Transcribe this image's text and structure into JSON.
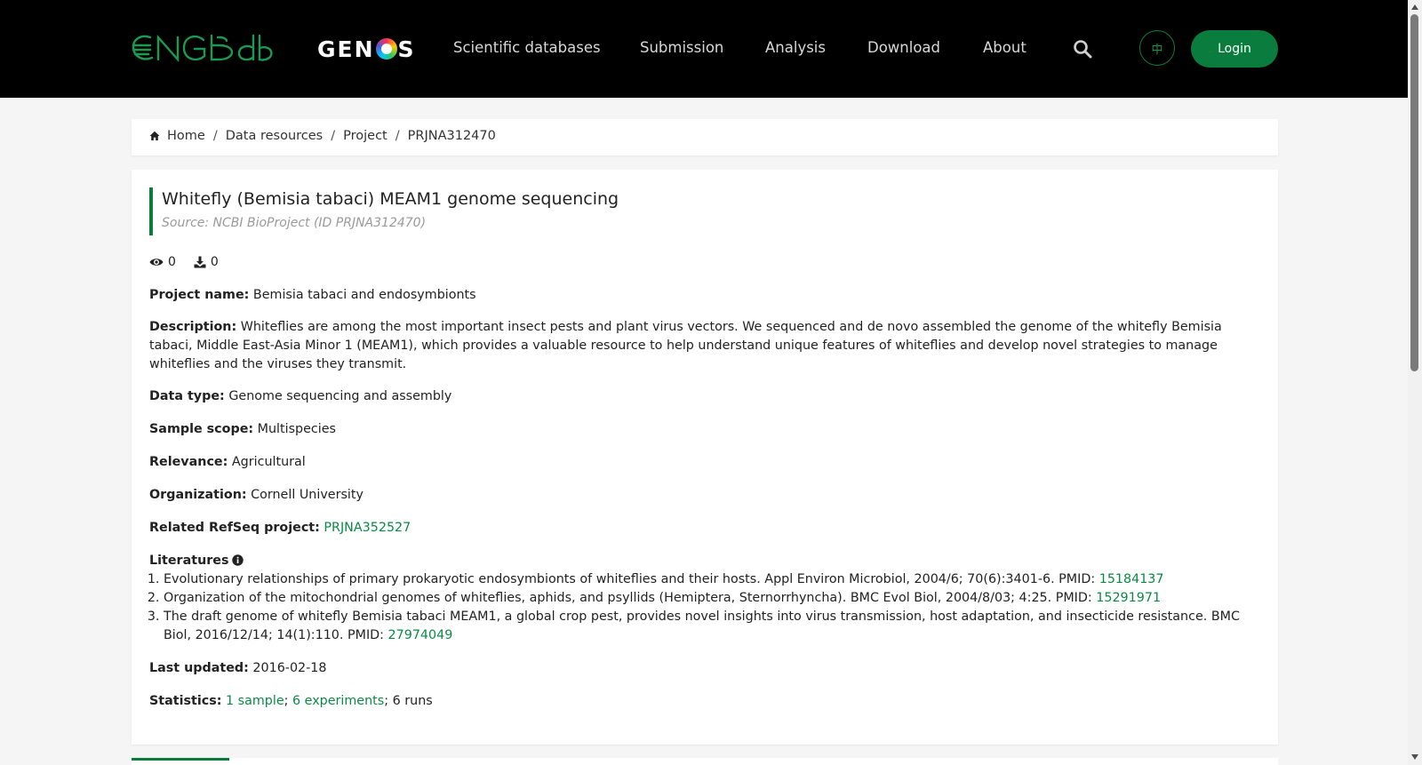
{
  "header": {
    "logo_text": "CNGBdb",
    "genos_logo": {
      "before": "GEN",
      "after": "S"
    },
    "nav": [
      {
        "label": "Scientific databases"
      },
      {
        "label": "Submission"
      },
      {
        "label": "Analysis"
      },
      {
        "label": "Download"
      },
      {
        "label": "About"
      }
    ],
    "lang_button": "中",
    "login_label": "Login",
    "accent_color": "#0a7c3e"
  },
  "breadcrumb": {
    "items": [
      "Home",
      "Data resources",
      "Project",
      "PRJNA312470"
    ],
    "separator": "/"
  },
  "project": {
    "title": "Whitefly (Bemisia tabaci) MEAM1 genome sequencing",
    "source": "Source: NCBI BioProject (ID PRJNA312470)",
    "views": "0",
    "downloads": "0",
    "fields": {
      "project_name": {
        "label": "Project name:",
        "value": "Bemisia tabaci and endosymbionts"
      },
      "description": {
        "label": "Description:",
        "value": "Whiteflies are among the most important insect pests and plant virus vectors. We sequenced and de novo assembled the genome of the whitefly Bemisia tabaci, Middle East-Asia Minor 1 (MEAM1), which provides a valuable resource to help understand unique features of whiteflies and develop novel strategies to manage whiteflies and the viruses they transmit."
      },
      "data_type": {
        "label": "Data type:",
        "value": "Genome sequencing and assembly"
      },
      "sample_scope": {
        "label": "Sample scope:",
        "value": "Multispecies"
      },
      "relevance": {
        "label": "Relevance:",
        "value": "Agricultural"
      },
      "organization": {
        "label": "Organization:",
        "value": "Cornell University"
      },
      "related_refseq": {
        "label": "Related RefSeq project:",
        "value": "PRJNA352527"
      }
    },
    "literatures": {
      "label": "Literatures",
      "items": [
        {
          "text": "Evolutionary relationships of primary prokaryotic endosymbionts of whiteflies and their hosts. Appl Environ Microbiol, 2004/6; 70(6):3401-6. PMID: ",
          "pmid": "15184137"
        },
        {
          "text": "Organization of the mitochondrial genomes of whiteflies, aphids, and psyllids (Hemiptera, Sternorrhyncha). BMC Evol Biol, 2004/8/03; 4:25. PMID: ",
          "pmid": "15291971"
        },
        {
          "text": "The draft genome of whitefly Bemisia tabaci MEAM1, a global crop pest, provides novel insights into virus transmission, host adaptation, and insecticide resistance. BMC Biol, 2016/12/14; 14(1):110. PMID: ",
          "pmid": "27974049"
        }
      ]
    },
    "last_updated": {
      "label": "Last updated:",
      "value": "2016-02-18"
    },
    "statistics": {
      "label": "Statistics:",
      "samples": "1 sample",
      "sep1": ";",
      "experiments": "6 experiments",
      "sep2": ";",
      "runs": "6 runs"
    }
  }
}
